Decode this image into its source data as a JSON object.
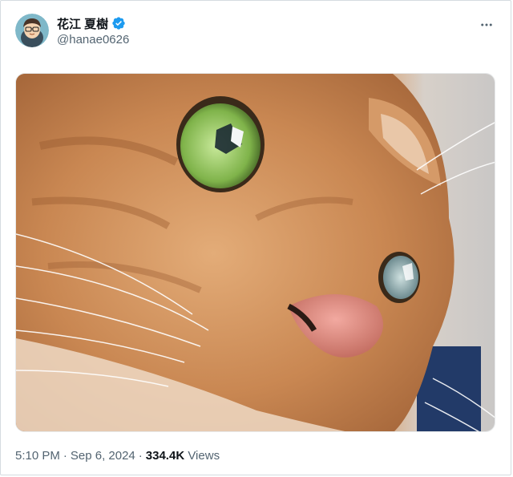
{
  "author": {
    "display_name": "花江 夏樹",
    "handle": "@hanae0626",
    "verified": true,
    "avatar_icon": "user-avatar"
  },
  "menu": {
    "icon": "more-horizontal-icon"
  },
  "media": {
    "icon": "cat-photo"
  },
  "meta": {
    "time": "5:10 PM",
    "separator": "·",
    "date": "Sep 6, 2024",
    "views_count": "334.4K",
    "views_label": "Views"
  },
  "colors": {
    "verified_blue": "#1d9bf0",
    "secondary_text": "#536471",
    "primary_text": "#0f1419"
  }
}
